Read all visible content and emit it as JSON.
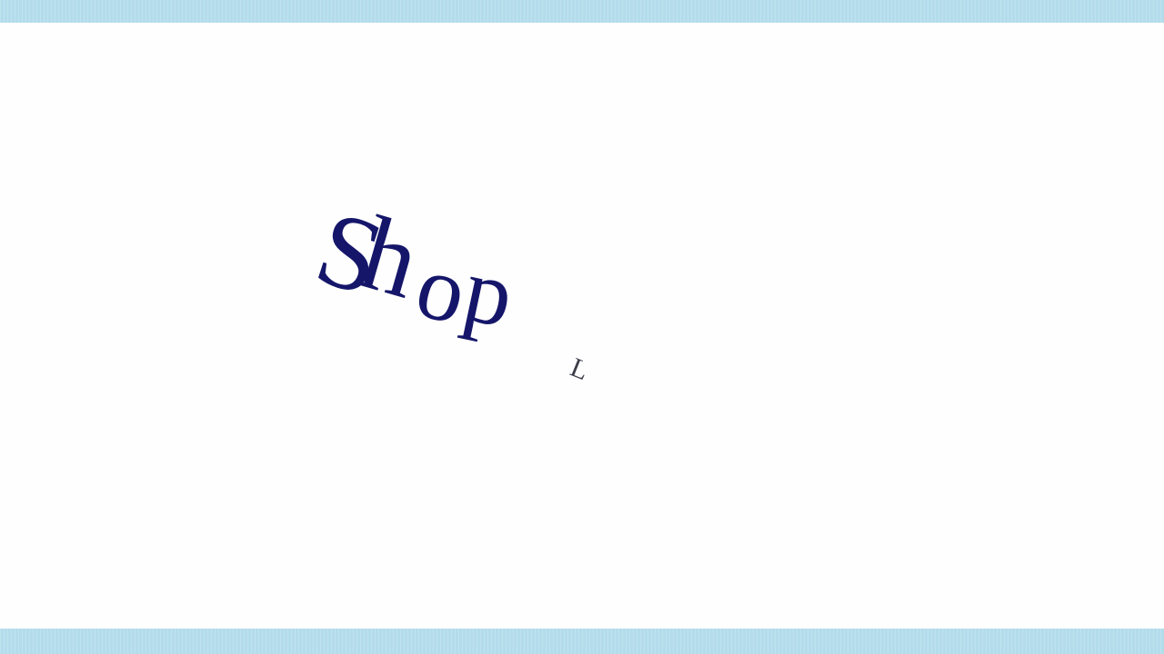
{
  "animation": {
    "word_letters": [
      "S",
      "h",
      "o",
      "p"
    ],
    "trailing_letter": "L"
  },
  "colors": {
    "banner": "#b3dceb",
    "text": "#15166a",
    "background": "#fefefe"
  }
}
